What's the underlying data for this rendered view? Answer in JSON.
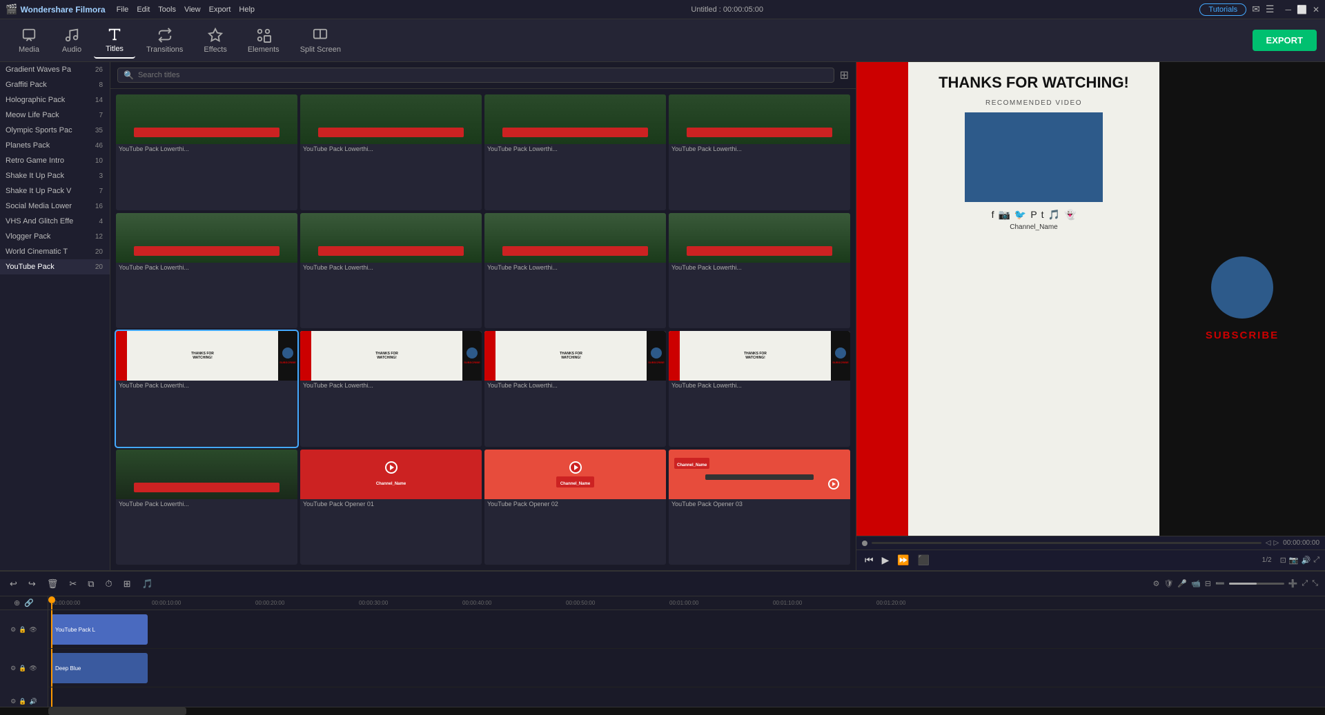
{
  "app": {
    "name": "Wondershare Filmora",
    "title": "Untitled : 00:00:05:00",
    "tutorials_label": "Tutorials"
  },
  "menu": {
    "items": [
      "File",
      "Edit",
      "Tools",
      "View",
      "Export",
      "Help"
    ]
  },
  "toolbar": {
    "items": [
      {
        "id": "media",
        "label": "Media",
        "icon": "film"
      },
      {
        "id": "audio",
        "label": "Audio",
        "icon": "music"
      },
      {
        "id": "titles",
        "label": "Titles",
        "icon": "text",
        "active": true
      },
      {
        "id": "transitions",
        "label": "Transitions",
        "icon": "transition"
      },
      {
        "id": "effects",
        "label": "Effects",
        "icon": "sparkle"
      },
      {
        "id": "elements",
        "label": "Elements",
        "icon": "elements"
      },
      {
        "id": "split",
        "label": "Split Screen",
        "icon": "split"
      }
    ],
    "export_label": "EXPORT"
  },
  "sidebar": {
    "items": [
      {
        "label": "Gradient Waves Pa",
        "count": 26
      },
      {
        "label": "Graffiti Pack",
        "count": 8
      },
      {
        "label": "Holographic Pack",
        "count": 14
      },
      {
        "label": "Meow Life Pack",
        "count": 7
      },
      {
        "label": "Olympic Sports Pac",
        "count": 35
      },
      {
        "label": "Planets Pack",
        "count": 46
      },
      {
        "label": "Retro Game Intro",
        "count": 10
      },
      {
        "label": "Shake It Up Pack",
        "count": 3
      },
      {
        "label": "Shake It Up Pack V",
        "count": 7
      },
      {
        "label": "Social Media Lower",
        "count": 16
      },
      {
        "label": "VHS And Glitch Effe",
        "count": 4
      },
      {
        "label": "Vlogger Pack",
        "count": 12
      },
      {
        "label": "World Cinematic T",
        "count": 20
      },
      {
        "label": "YouTube Pack",
        "count": 20,
        "active": true
      }
    ]
  },
  "search": {
    "placeholder": "Search titles"
  },
  "thumbnails": {
    "rows": [
      [
        {
          "label": "YouTube Pack Lowerthi...",
          "bg": "#1a2a1a"
        },
        {
          "label": "YouTube Pack Lowerthi...",
          "bg": "#1a2a1a"
        },
        {
          "label": "YouTube Pack Lowerthi...",
          "bg": "#1a2a1a"
        },
        {
          "label": "YouTube Pack Lowerthi...",
          "bg": "#1a2a1a"
        }
      ],
      [
        {
          "label": "YouTube Pack Lowerthi...",
          "bg": "#1a2a1a"
        },
        {
          "label": "YouTube Pack Lowerthi...",
          "bg": "#1a2a1a"
        },
        {
          "label": "YouTube Pack Lowerthi...",
          "bg": "#1a2a1a"
        },
        {
          "label": "YouTube Pack Lowerthi...",
          "bg": "#1a2a1a"
        }
      ],
      [
        {
          "label": "YouTube Pack Lowerthi...",
          "bg": "#f5f5f0",
          "selected": true
        },
        {
          "label": "YouTube Pack Lowerthi...",
          "bg": "#f5f5f0"
        },
        {
          "label": "YouTube Pack Lowerthi...",
          "bg": "#f5f5f0"
        },
        {
          "label": "YouTube Pack Lowerthi...",
          "bg": "#f5f5f0"
        }
      ],
      [
        {
          "label": "YouTube Pack Lowerthi...",
          "bg": "#1a2a1a"
        },
        {
          "label": "YouTube Pack Opener 01",
          "bg": "#cc2222"
        },
        {
          "label": "YouTube Pack Opener 02",
          "bg": "#e74c3c"
        },
        {
          "label": "YouTube Pack Opener 03",
          "bg": "#e74c3c"
        }
      ]
    ]
  },
  "preview": {
    "thanks_text": "THANKS FOR WATCHING!",
    "rec_label": "RECOMMENDED VIDEO",
    "subscribe_text": "SUBSCRIBE",
    "channel_name": "Channel_Name",
    "time_current": "00:00:00:00",
    "page_info": "1/2",
    "progress_pct": 0
  },
  "timeline": {
    "current_time": "00:00:00:00",
    "time_markers": [
      "00:00:00:00",
      "00:00:10:00",
      "00:00:20:00",
      "00:00:30:00",
      "00:00:40:00",
      "00:00:50:00",
      "00:01:00:00",
      "00:01:10:00",
      "00:01:20:00"
    ],
    "tracks": [
      {
        "id": "video1",
        "clips": [
          {
            "label": "YouTube Pack L",
            "color": "#4a6abf",
            "left": 0,
            "width": 78
          }
        ]
      },
      {
        "id": "video2",
        "clips": [
          {
            "label": "Deep Blue",
            "color": "#3a5a9f",
            "left": 0,
            "width": 78
          }
        ]
      },
      {
        "id": "audio1",
        "clips": []
      }
    ]
  }
}
